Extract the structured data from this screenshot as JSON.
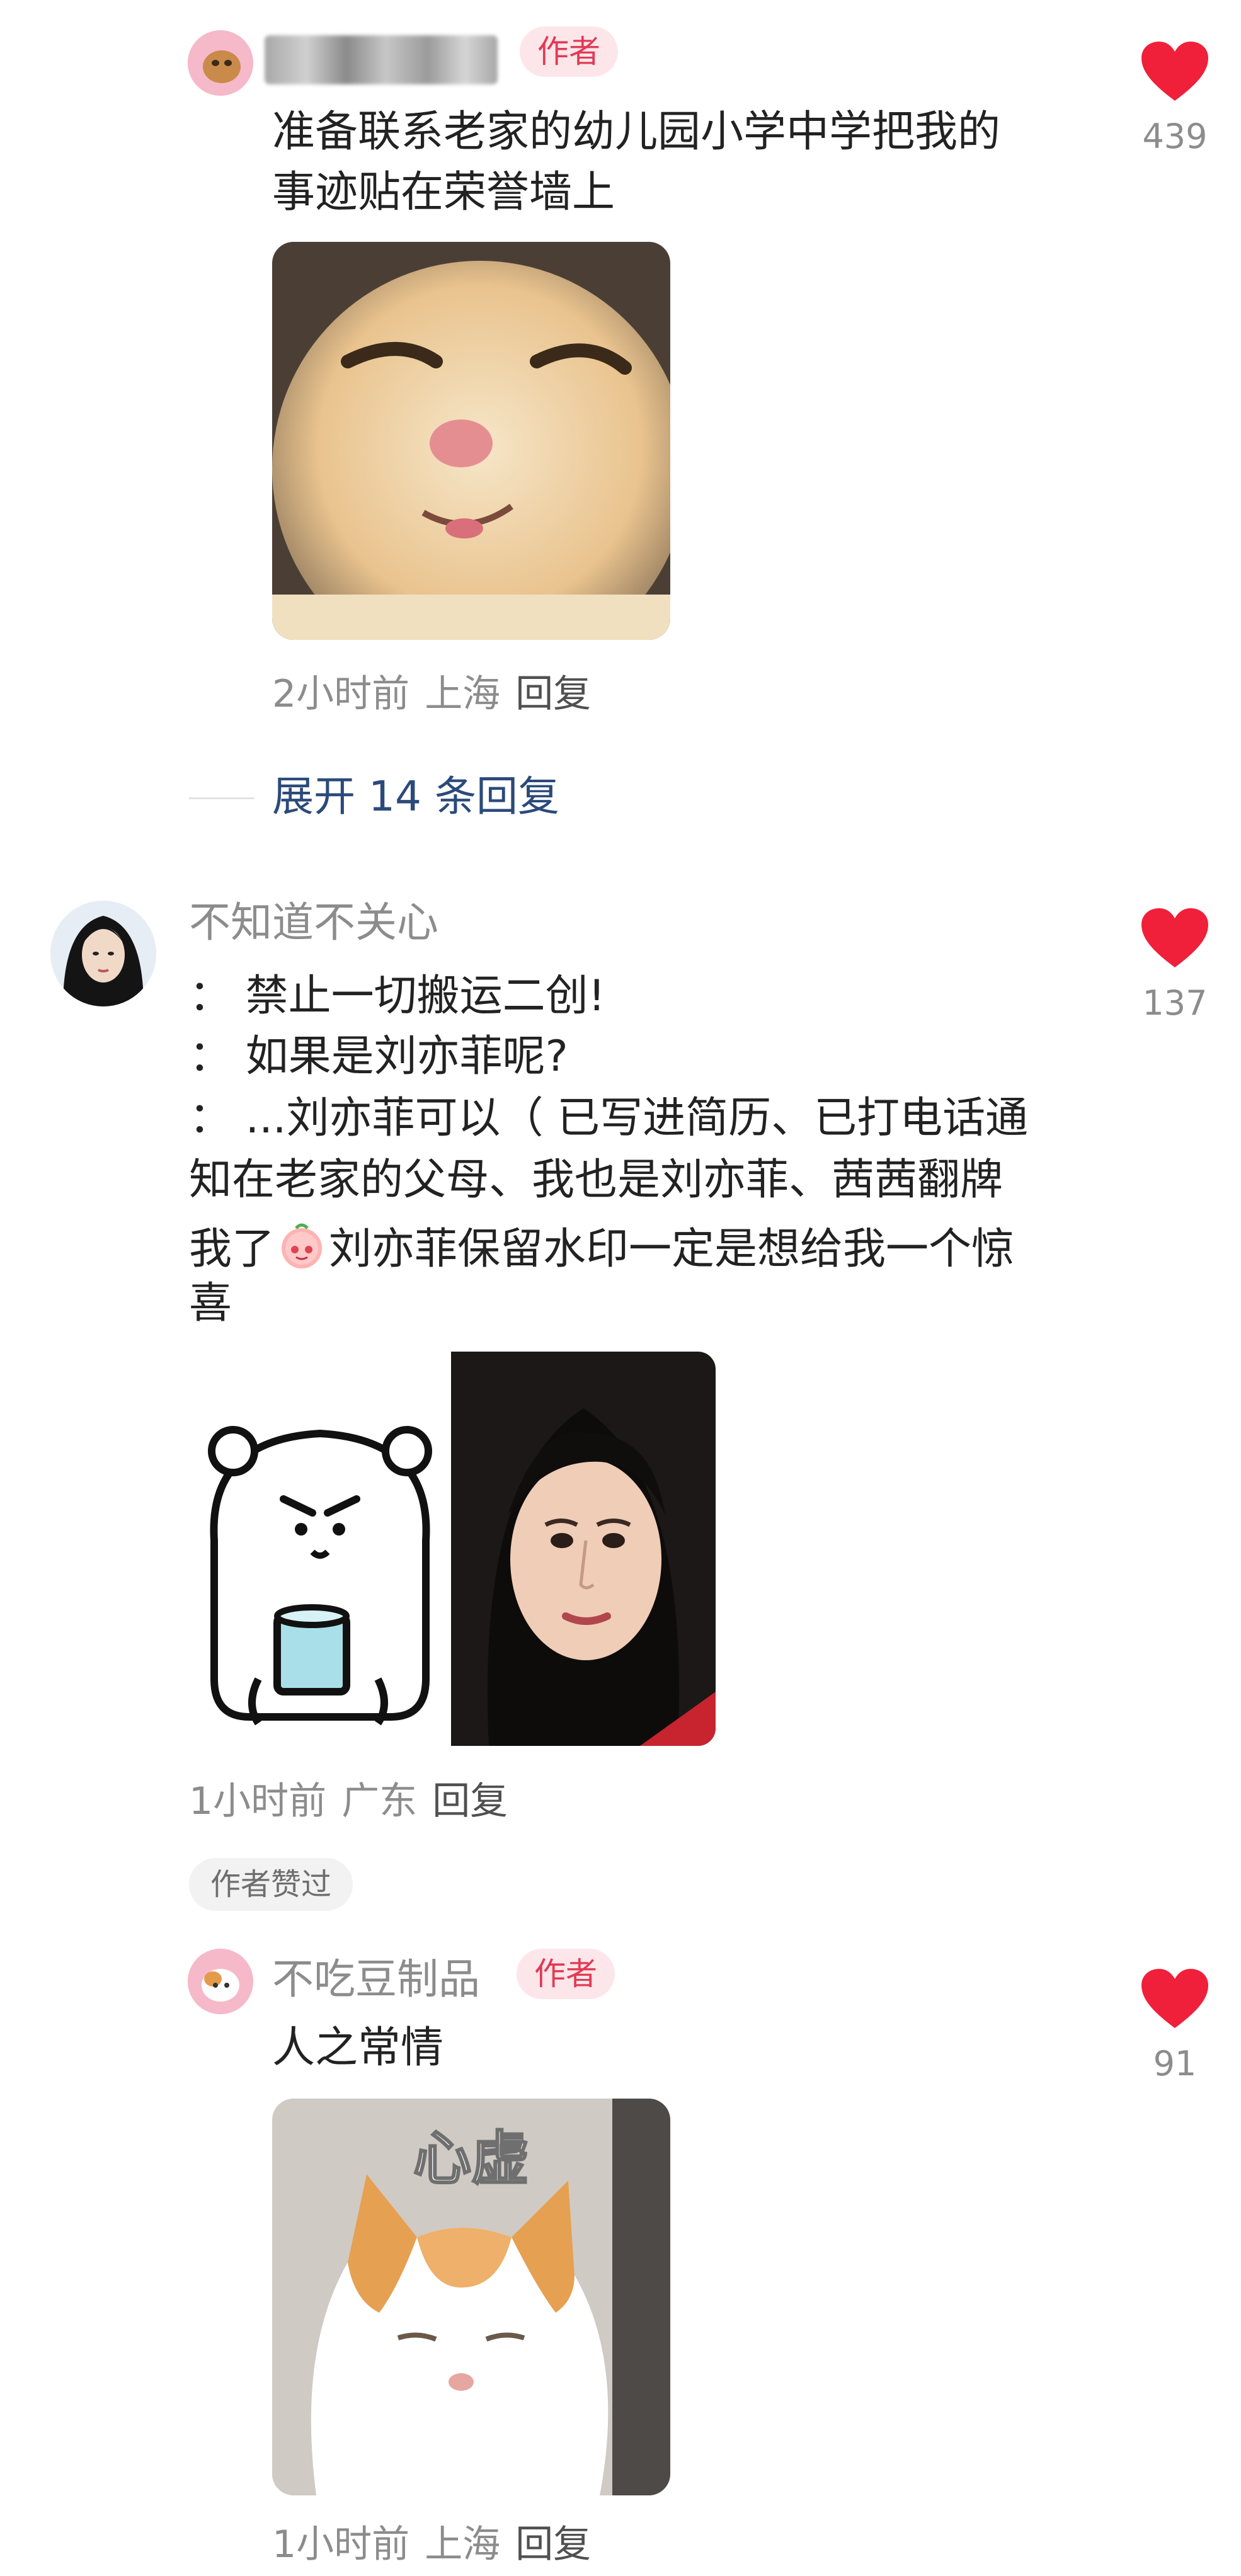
{
  "comments": [
    {
      "author_tag": "作者",
      "text_lines": [
        "准备联系老家的幼儿园小学中学把我的",
        "事迹贴在荣誉墙上"
      ],
      "time": "2小时前",
      "location": "上海",
      "reply_label": "回复",
      "likes": "439",
      "image_icon": "cat-squint-image"
    },
    {
      "expand_label": "展开 14 条回复"
    },
    {
      "username": "不知道不关心",
      "text_lines": [
        "：  禁止一切搬运二创!",
        "：  如果是刘亦菲呢?",
        "：  ...刘亦菲可以（ 已写进简历、已打电话通",
        "知在老家的父母、我也是刘亦菲、茜茜翻牌",
        "我了",
        "刘亦菲保留水印一定是想给我一个惊",
        "喜"
      ],
      "time": "1小时前",
      "location": "广东",
      "reply_label": "回复",
      "likes": "137",
      "liked_badge": "作者赞过",
      "image_icons": [
        "bear-meme-image",
        "portrait-photo-image"
      ]
    },
    {
      "username": "不吃豆制品",
      "author_tag": "作者",
      "text_lines": [
        "人之常情"
      ],
      "image_caption": "心虚",
      "time": "1小时前",
      "location": "上海",
      "reply_label": "回复",
      "likes": "91",
      "image_icon": "cat-guilty-image"
    }
  ],
  "colors": {
    "heart": "#f0203a",
    "author_tag_bg": "#fde6ea",
    "author_tag_text": "#e13b55",
    "expand_link": "#2b4a7a",
    "meta_text": "#8c8c8c"
  }
}
